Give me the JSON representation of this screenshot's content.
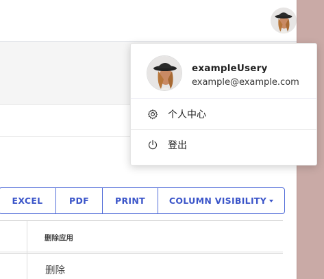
{
  "user": {
    "name": "exampleUsery",
    "email": "example@example.com"
  },
  "user_menu": {
    "items": [
      {
        "label": "个人中心",
        "icon": "gear-icon"
      },
      {
        "label": "登出",
        "icon": "power-icon"
      }
    ]
  },
  "export_buttons": {
    "excel": "EXCEL",
    "pdf": "PDF",
    "print": "PRINT",
    "column_visibility": "COLUMN VISIBILITY"
  },
  "table": {
    "headers": [
      "",
      "删除应用"
    ],
    "rows": [
      [
        "",
        "删除"
      ]
    ]
  },
  "colors": {
    "accent": "#3b55c9",
    "button_border": "#4f6bd8"
  }
}
